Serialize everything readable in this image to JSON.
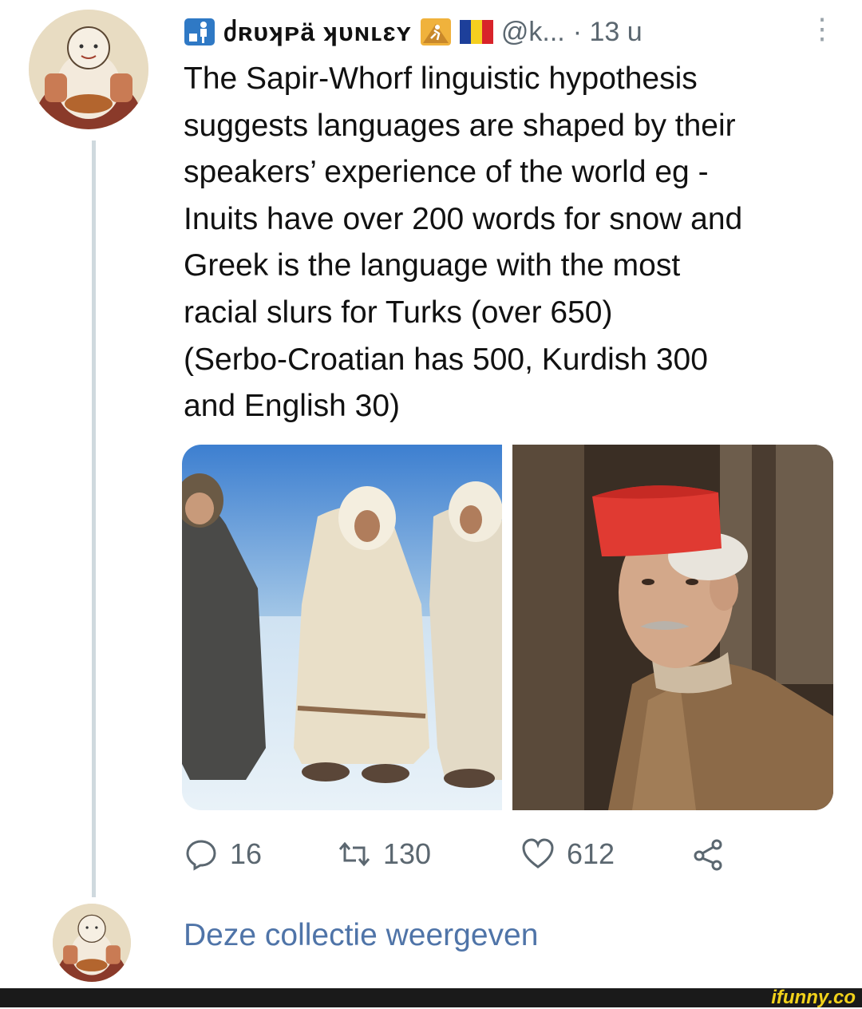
{
  "tweet": {
    "display_name": "ძʀᴜʞᴘä ʞᴜɴʟɛʏ",
    "handle": "@k...",
    "time": "· 13 u",
    "more_icon": "more-vertical-icon",
    "lines": [
      "The Sapir-Whorf linguistic hypothesis",
      "suggests languages are shaped by their",
      "speakers’ experience of the world eg -",
      "Inuits have over 200 words for snow and",
      "Greek is the language with the most",
      "racial slurs for Turks (over 650)",
      "(Serbo-Croatian has 500, Kurdish 300",
      "and English 30)"
    ],
    "images": [
      "photo-people-in-fur-coats-on-snow",
      "photo-old-man-in-red-fez"
    ]
  },
  "actions": {
    "reply_count": "16",
    "retweet_count": "130",
    "like_count": "612"
  },
  "footer": {
    "show_collection": "Deze collectie weergeven",
    "watermark": "ifunny.co"
  },
  "colors": {
    "text": "#111111",
    "secondary": "#5b6770",
    "link": "#4f74a8",
    "thread_line": "#cfd9de",
    "flag_blue": "#1d3f9a",
    "flag_yellow": "#f5cf1f",
    "flag_red": "#d8232a",
    "watermark": "#f2d21b"
  }
}
